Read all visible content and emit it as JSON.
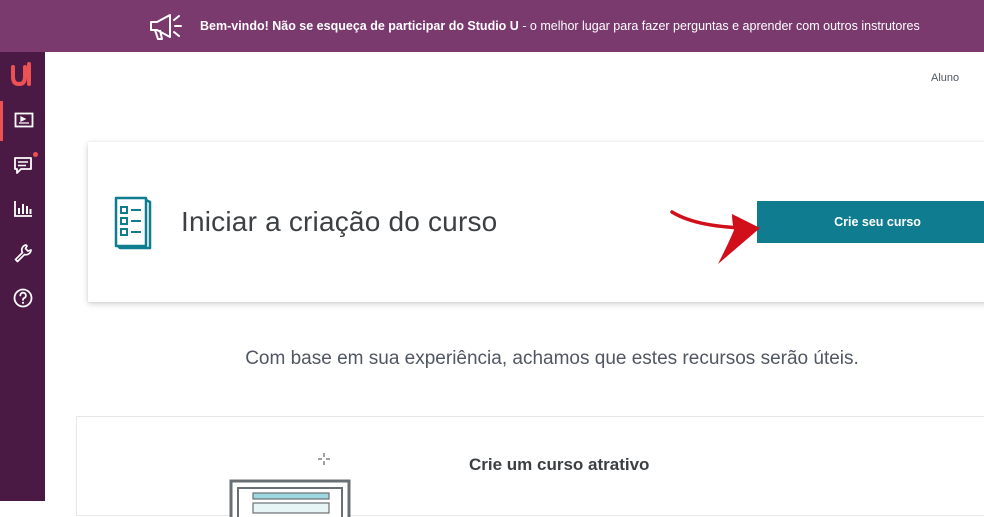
{
  "banner": {
    "bold_text": "Bem-vindo! Não se esqueça de participar do Studio U",
    "rest_text": " - o melhor lugar para fazer perguntas e aprender com outros instrutores",
    "icon": "megaphone-icon"
  },
  "sidebar": {
    "logo": "udemy-logo",
    "items": [
      {
        "icon": "courses-icon",
        "active": true
      },
      {
        "icon": "communication-icon",
        "notification": true
      },
      {
        "icon": "performance-icon"
      },
      {
        "icon": "tools-icon"
      },
      {
        "icon": "help-icon"
      }
    ]
  },
  "header": {
    "role_link": "Aluno"
  },
  "create_card": {
    "title": "Iniciar a criação do curso",
    "button_label": "Crie seu curso"
  },
  "resources": {
    "subtitle": "Com base em sua experiência, achamos que estes recursos serão úteis.",
    "panel_title": "Crie um curso atrativo"
  },
  "colors": {
    "banner": "#7a3a6e",
    "sidebar": "#4a1a45",
    "accent": "#ec5252",
    "button": "#0f7c90"
  }
}
